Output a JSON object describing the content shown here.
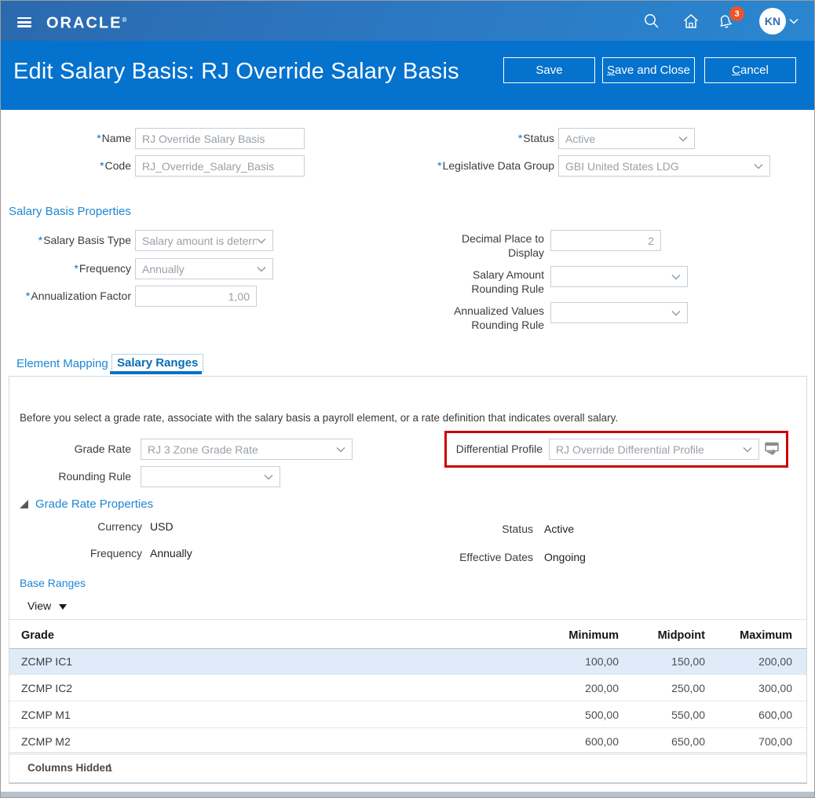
{
  "ui": {
    "required_marker": "*",
    "logo_mark": "®"
  },
  "topbar": {
    "brand": "ORACLE",
    "notification_count": "3",
    "avatar_initials": "KN"
  },
  "header": {
    "title": "Edit Salary Basis: RJ Override Salary Basis",
    "buttons": {
      "save": "Save",
      "save_and_close_prefix": "S",
      "save_and_close_rest": "ave and Close",
      "cancel_prefix": "C",
      "cancel_rest": "ancel"
    }
  },
  "form": {
    "name": {
      "label": "Name",
      "value": "RJ Override Salary Basis"
    },
    "code": {
      "label": "Code",
      "value": "RJ_Override_Salary_Basis"
    },
    "status": {
      "label": "Status",
      "value": "Active"
    },
    "legislative_data_group": {
      "label": "Legislative Data Group",
      "value": "GBI United States LDG"
    }
  },
  "salary_basis_properties": {
    "heading": "Salary Basis Properties",
    "salary_basis_type": {
      "label": "Salary Basis Type",
      "value": "Salary amount is detern"
    },
    "frequency": {
      "label": "Frequency",
      "value": "Annually"
    },
    "annualization_factor": {
      "label": "Annualization Factor",
      "value": "1,00"
    },
    "decimal_place": {
      "label_line1": "Decimal Place to",
      "label_line2": "Display",
      "value": "2"
    },
    "salary_amount_rounding": {
      "label_line1": "Salary Amount",
      "label_line2": "Rounding Rule",
      "value": ""
    },
    "annualized_values_rounding": {
      "label_line1": "Annualized Values",
      "label_line2": "Rounding Rule",
      "value": ""
    }
  },
  "tabs": {
    "element_mapping": "Element Mapping",
    "salary_ranges": "Salary Ranges"
  },
  "salary_ranges_tab": {
    "instruction": "Before you select a grade rate, associate with the salary basis a payroll element, or a rate definition that indicates overall salary.",
    "grade_rate": {
      "label": "Grade Rate",
      "value": "RJ 3 Zone Grade Rate"
    },
    "differential_profile": {
      "label": "Differential Profile",
      "value": "RJ Override Differential Profile"
    },
    "rounding_rule": {
      "label": "Rounding Rule",
      "value": ""
    },
    "grade_rate_properties": {
      "heading": "Grade Rate Properties",
      "currency_label": "Currency",
      "currency_value": "USD",
      "frequency_label": "Frequency",
      "frequency_value": "Annually",
      "status_label": "Status",
      "status_value": "Active",
      "effective_dates_label": "Effective Dates",
      "effective_dates_value": "Ongoing"
    },
    "base_ranges": {
      "heading": "Base Ranges",
      "view_menu_label": "View",
      "columns": {
        "grade": "Grade",
        "minimum": "Minimum",
        "midpoint": "Midpoint",
        "maximum": "Maximum"
      },
      "rows": [
        {
          "grade": "ZCMP IC1",
          "minimum": "100,00",
          "midpoint": "150,00",
          "maximum": "200,00"
        },
        {
          "grade": "ZCMP IC2",
          "minimum": "200,00",
          "midpoint": "250,00",
          "maximum": "300,00"
        },
        {
          "grade": "ZCMP M1",
          "minimum": "500,00",
          "midpoint": "550,00",
          "maximum": "600,00"
        },
        {
          "grade": "ZCMP M2",
          "minimum": "600,00",
          "midpoint": "650,00",
          "maximum": "700,00"
        }
      ],
      "columns_hidden_label": "Columns Hidden",
      "columns_hidden_count": "1"
    }
  },
  "colors": {
    "brand_blue": "#0572ce",
    "topbar_gradient_start": "#2b69ae",
    "topbar_gradient_end": "#2a86d0",
    "highlight_red": "#cc0404",
    "row_highlight": "#dfebf9",
    "badge_orange": "#e8562d",
    "link_blue": "#1e87d5"
  }
}
